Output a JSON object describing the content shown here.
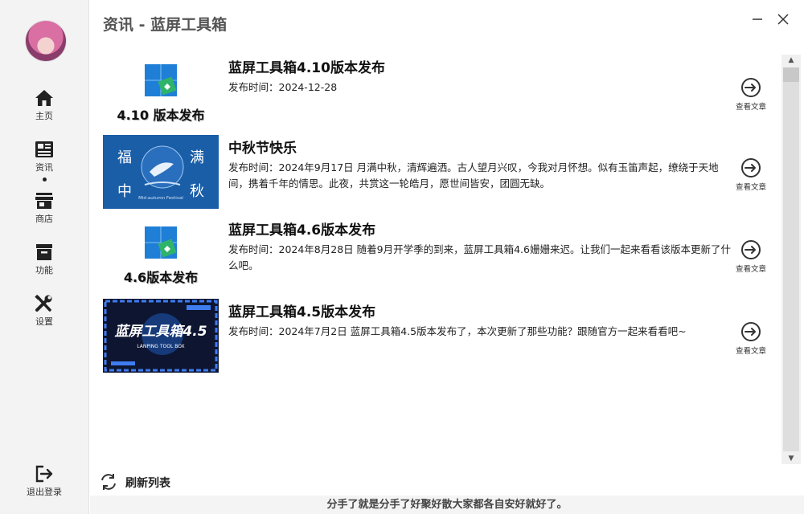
{
  "window": {
    "title": "资讯 - 蓝屏工具箱"
  },
  "sidebar": {
    "items": [
      {
        "label": "主页",
        "icon": "home-icon"
      },
      {
        "label": "资讯",
        "icon": "news-icon"
      },
      {
        "label": "商店",
        "icon": "store-icon"
      },
      {
        "label": "功能",
        "icon": "box-icon"
      },
      {
        "label": "设置",
        "icon": "tools-icon"
      }
    ],
    "logout_label": "退出登录"
  },
  "articles": [
    {
      "title": "蓝屏工具箱4.10版本发布",
      "desc": "发布时间：2024-12-28",
      "thumb_caption": "4.10 版本发布",
      "action": "查看文章"
    },
    {
      "title": "中秋节快乐",
      "desc": "发布时间：2024年9月17日 月满中秋，清辉遍洒。古人望月兴叹，今我对月怀想。似有玉笛声起，缭绕于天地间，携着千年的情思。此夜，共赏这一轮皓月，愿世间皆安，团圆无缺。",
      "thumb_chars": [
        "福",
        "满",
        "中",
        "秋"
      ],
      "thumb_caption": "Mid-autumn Festival",
      "action": "查看文章"
    },
    {
      "title": "蓝屏工具箱4.6版本发布",
      "desc": "发布时间：2024年8月28日 随着9月开学季的到来，蓝屏工具箱4.6姗姗来迟。让我们一起来看看该版本更新了什么吧。",
      "thumb_caption": "4.6版本发布",
      "action": "查看文章"
    },
    {
      "title": "蓝屏工具箱4.5版本发布",
      "desc": "发布时间：2024年7月2日 蓝屏工具箱4.5版本发布了，本次更新了那些功能？跟随官方一起来看看吧~",
      "thumb_caption": "蓝屏工具箱4.5",
      "thumb_sub": "LANPING TOOL BOX",
      "action": "查看文章"
    }
  ],
  "refresh_label": "刷新列表",
  "footer_text": "分手了就是分手了好聚好散大家都各自安好就好了。",
  "colors": {
    "accent": "#1a5ea8",
    "app_icon_blue": "#1f7fd6",
    "app_icon_green": "#2fb36b"
  }
}
